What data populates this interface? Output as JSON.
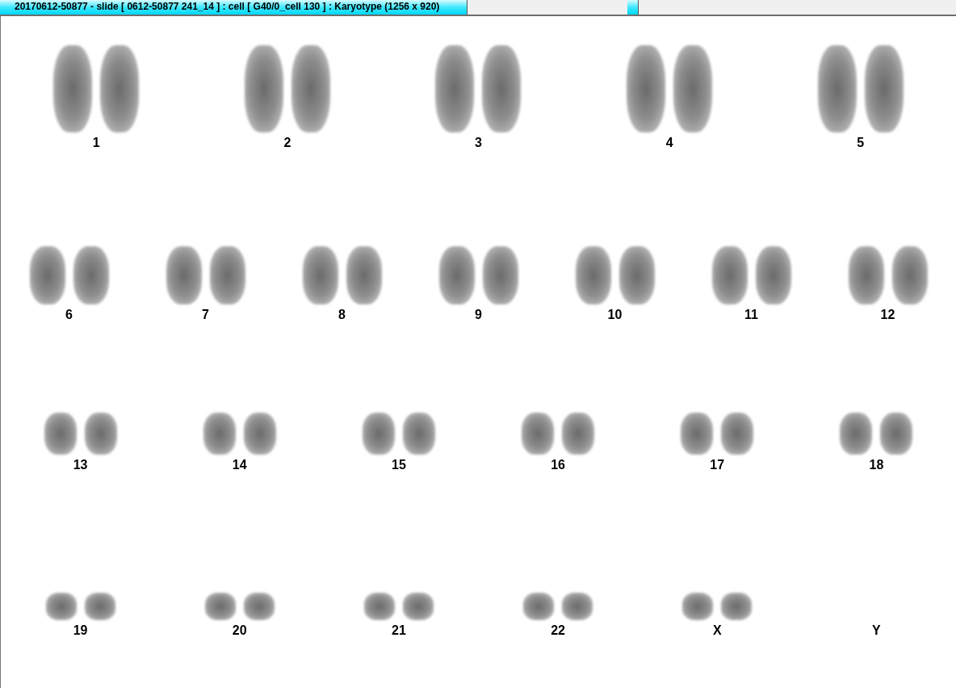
{
  "window": {
    "title": "20170612-50877 - slide [ 0612-50877 241_14 ] : cell [ G40/0_cell 130 ] : Karyotype  (1256 x 920)"
  },
  "karyotype": {
    "rows": [
      {
        "pairs": [
          {
            "label": "1",
            "has_image": true
          },
          {
            "label": "2",
            "has_image": true
          },
          {
            "label": "3",
            "has_image": true
          },
          {
            "label": "4",
            "has_image": true
          },
          {
            "label": "5",
            "has_image": true
          }
        ]
      },
      {
        "pairs": [
          {
            "label": "6",
            "has_image": true
          },
          {
            "label": "7",
            "has_image": true
          },
          {
            "label": "8",
            "has_image": true
          },
          {
            "label": "9",
            "has_image": true
          },
          {
            "label": "10",
            "has_image": true
          },
          {
            "label": "11",
            "has_image": true
          },
          {
            "label": "12",
            "has_image": true
          }
        ]
      },
      {
        "pairs": [
          {
            "label": "13",
            "has_image": true
          },
          {
            "label": "14",
            "has_image": true
          },
          {
            "label": "15",
            "has_image": true
          },
          {
            "label": "16",
            "has_image": true
          },
          {
            "label": "17",
            "has_image": true
          },
          {
            "label": "18",
            "has_image": true
          }
        ]
      },
      {
        "pairs": [
          {
            "label": "19",
            "has_image": true
          },
          {
            "label": "20",
            "has_image": true
          },
          {
            "label": "21",
            "has_image": true
          },
          {
            "label": "22",
            "has_image": true
          },
          {
            "label": "X",
            "has_image": true
          },
          {
            "label": "Y",
            "has_image": false
          }
        ]
      }
    ]
  }
}
